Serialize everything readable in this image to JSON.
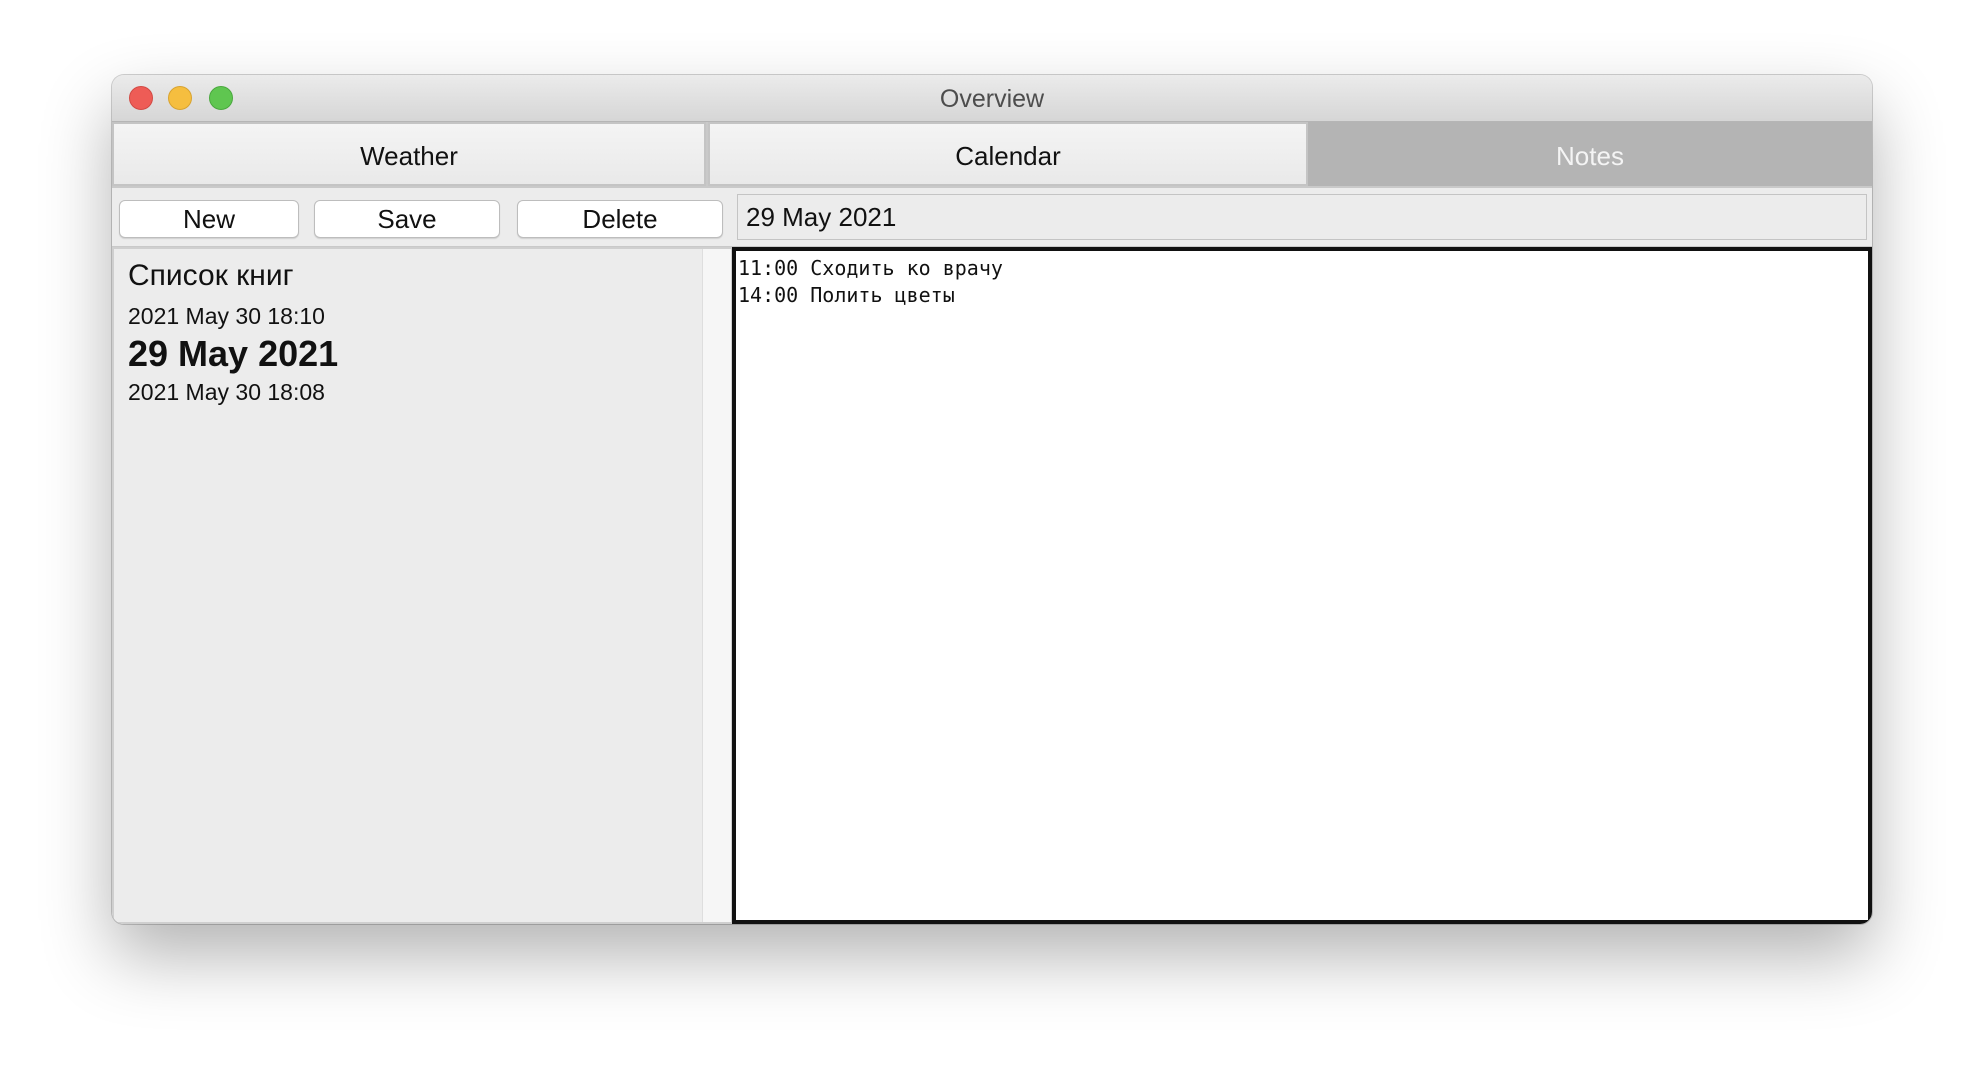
{
  "window": {
    "title": "Overview",
    "controls": [
      "close",
      "minimize",
      "zoom"
    ]
  },
  "tabs": [
    {
      "label": "Weather",
      "selected": false
    },
    {
      "label": "Calendar",
      "selected": false
    },
    {
      "label": "Notes",
      "selected": true
    }
  ],
  "toolbar": {
    "new_label": "New",
    "save_label": "Save",
    "delete_label": "Delete",
    "note_title_value": "29 May 2021"
  },
  "notes_list": [
    {
      "title": "Список книг",
      "time": "2021 May 30 18:10",
      "selected": false
    },
    {
      "title": "29 May 2021",
      "time": "2021 May 30 18:08",
      "selected": true
    }
  ],
  "editor": {
    "lines": [
      "11:00 Сходить ко врачу",
      "14:00 Полить цветы"
    ]
  },
  "colors": {
    "close": "#ee5c56",
    "minimize": "#f5be3f",
    "zoom": "#5fc650",
    "selected_tab_bg": "#b4b4b4",
    "editor_border": "#111111"
  }
}
